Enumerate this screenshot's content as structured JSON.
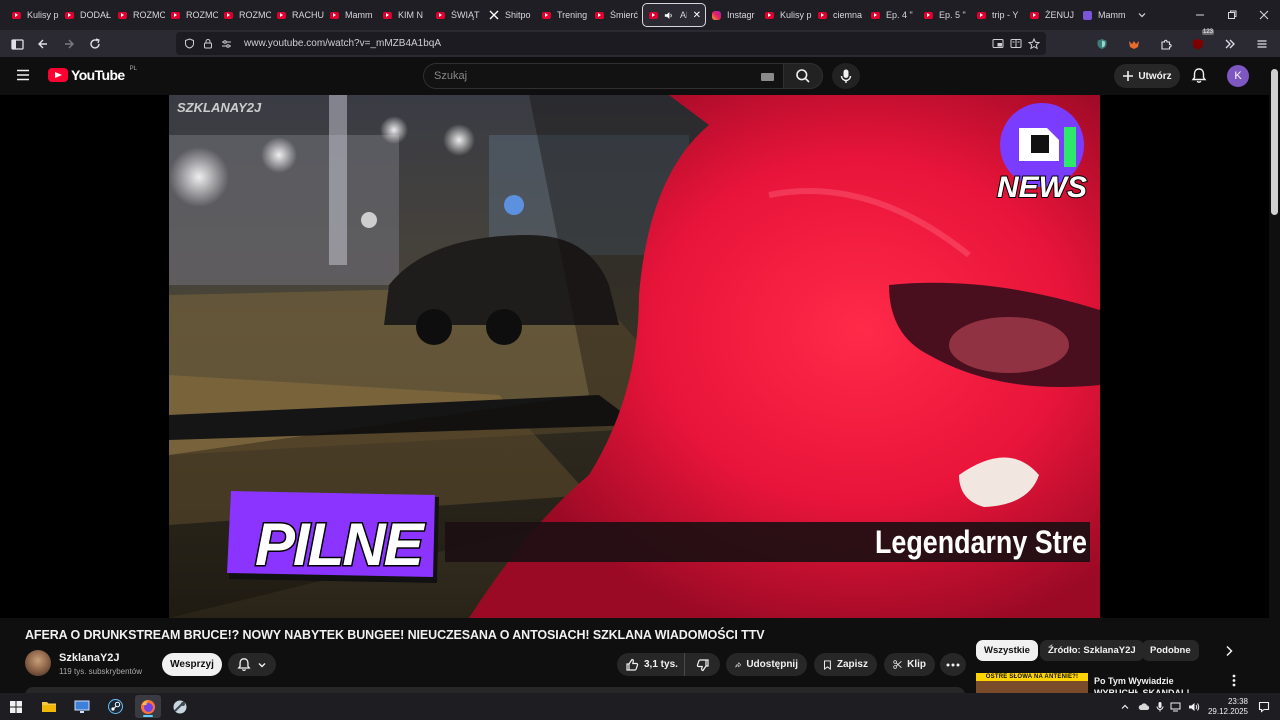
{
  "browser": {
    "tabs": [
      {
        "label": "Kulisy p",
        "icon": "youtube-icon"
      },
      {
        "label": "DODAŁ",
        "icon": "youtube-icon"
      },
      {
        "label": "ROZMO",
        "icon": "youtube-icon"
      },
      {
        "label": "ROZMO",
        "icon": "youtube-icon"
      },
      {
        "label": "ROZMO",
        "icon": "youtube-icon"
      },
      {
        "label": "RACHU",
        "icon": "youtube-icon"
      },
      {
        "label": "Mamm",
        "icon": "youtube-icon"
      },
      {
        "label": "KIM N",
        "icon": "youtube-icon"
      },
      {
        "label": "ŚWIĄT",
        "icon": "youtube-icon"
      },
      {
        "label": "Shitpo",
        "icon": "x-icon"
      },
      {
        "label": "Trening",
        "icon": "youtube-icon"
      },
      {
        "label": "Śmierć",
        "icon": "youtube-icon"
      },
      {
        "label": "AFE",
        "icon": "youtube-icon",
        "active": true
      },
      {
        "label": "Instagr",
        "icon": "instagram-icon"
      },
      {
        "label": "Kulisy p",
        "icon": "youtube-icon"
      },
      {
        "label": "ciemna",
        "icon": "youtube-icon"
      },
      {
        "label": "Ep. 4 \"",
        "icon": "youtube-icon"
      },
      {
        "label": "Ep. 5 \"",
        "icon": "youtube-icon"
      },
      {
        "label": "trip - Y",
        "icon": "youtube-icon"
      },
      {
        "label": "ŻENUJ",
        "icon": "youtube-icon"
      },
      {
        "label": "Mamm",
        "icon": "mammoth-icon"
      }
    ],
    "url": "www.youtube.com/watch?v=_mMZB4A1bqA",
    "extension_badge": "123"
  },
  "youtube": {
    "logo_text": "YouTube",
    "country_code": "PL",
    "search_placeholder": "Szukaj",
    "create_label": "Utwórz",
    "account_initial": "K"
  },
  "video": {
    "watermark": "SZKLANAY2J",
    "corner_logo_text": "NEWS",
    "badge_text": "PILNE",
    "ticker_text": "Legendarny Stre"
  },
  "meta": {
    "title": "AFERA O DRUNKSTREAM BRUCE!? NOWY NABYTEK BUNGEE! NIEUCZESANA O ANTOSIACH! SZKLANA WIADOMOŚCI TTV",
    "channel_name": "SzklanaY2J",
    "subscribers": "119 tys. subskrybentów",
    "support_label": "Wesprzyj",
    "likes": "3,1 tys.",
    "share_label": "Udostępnij",
    "save_label": "Zapisz",
    "clip_label": "Klip"
  },
  "sidebar": {
    "chips": [
      "Wszystkie",
      "Źródło: SzklanaY2J",
      "Podobne"
    ],
    "active_chip": "Wszystkie",
    "recommendation": {
      "thumb_banner": "OSTRE SŁOWA NA ANTENIE?!",
      "title": "Po Tym Wywiadzie WYBUCHŁ SKANDAL! Wściekły Stanowsk"
    }
  },
  "taskbar": {
    "time": "23:38",
    "date": "29.12.2025"
  },
  "colors": {
    "youtube_red": "#ff0033",
    "badge_purple": "#8b34ff",
    "background": "#0f0f0f"
  }
}
